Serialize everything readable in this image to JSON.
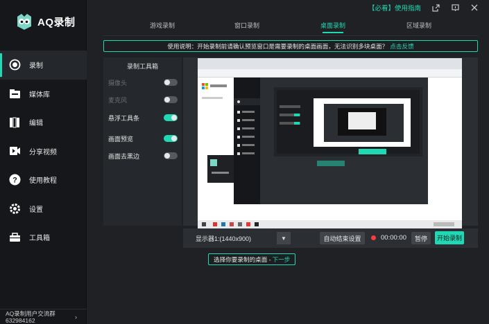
{
  "app": {
    "name": "AQ录制"
  },
  "topbar": {
    "help_link": "【必看】使用指南",
    "icons": [
      "export-icon",
      "feedback-icon",
      "close-icon"
    ]
  },
  "sidebar": {
    "items": [
      {
        "label": "录制",
        "icon": "record-icon",
        "active": true
      },
      {
        "label": "媒体库",
        "icon": "media-library-icon"
      },
      {
        "label": "编辑",
        "icon": "edit-icon"
      },
      {
        "label": "分享视频",
        "icon": "share-video-icon"
      },
      {
        "label": "使用教程",
        "icon": "help-icon"
      },
      {
        "label": "设置",
        "icon": "settings-icon"
      },
      {
        "label": "工具箱",
        "icon": "toolbox-icon"
      }
    ],
    "footer": {
      "line1": "AQ录制用户交流群",
      "line2": "632984162"
    }
  },
  "tabs": [
    {
      "label": "游戏录制"
    },
    {
      "label": "窗口录制"
    },
    {
      "label": "桌面录制",
      "active": true
    },
    {
      "label": "区域录制"
    }
  ],
  "notice": {
    "text": "使用说明：开始录制前请确认预览窗口是需要录制的桌面画面，无法识别多块桌面？",
    "link": "点击反馈"
  },
  "toolbox": {
    "title": "录制工具箱",
    "options": [
      {
        "label": "摄像头",
        "on": false,
        "disabled": true
      },
      {
        "label": "麦克风",
        "on": false,
        "disabled": true
      },
      {
        "label": "悬浮工具条",
        "on": true,
        "disabled": false
      },
      {
        "label": "画面预览",
        "on": true,
        "disabled": false
      },
      {
        "label": "画面去黑边",
        "on": false,
        "disabled": false
      }
    ]
  },
  "controls": {
    "display": "显示器1:(1440x900)",
    "auto_stop": "自动结束设置",
    "timer": "00:00:00",
    "pause": "暂停",
    "start": "开始录制"
  },
  "hint": {
    "text": "选择你要录制的桌面 -",
    "next": "下一步"
  },
  "colors": {
    "accent": "#21d8b4",
    "record": "#ff3b3b",
    "bg": "#1f2124",
    "sidebar": "#15171a"
  }
}
